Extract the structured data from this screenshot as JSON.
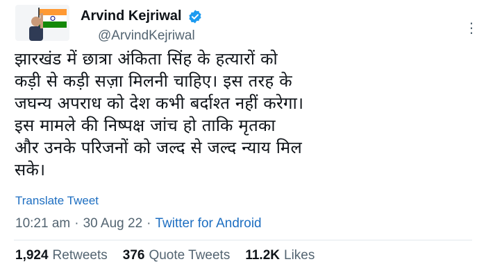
{
  "header": {
    "name": "Arvind Kejriwal",
    "handle": "@ArvindKejriwal",
    "verified_color": "#1d9bf0"
  },
  "tweet": {
    "text": "झारखंड में छात्रा अंकिता सिंह के हत्यारों को\nकड़ी से कड़ी सज़ा मिलनी चाहिए। इस तरह के\nजघन्य अपराध को देश कभी बर्दाश्त नहीं करेगा।\nइस मामले की निष्पक्ष जांच हो ताकि मृतका\nऔर उनके परिजनों को जल्द से जल्द न्याय मिल\nसके।",
    "translate_label": "Translate Tweet"
  },
  "meta": {
    "time": "10:21 am",
    "sep1": "·",
    "date": "30 Aug 22",
    "sep2": "·",
    "source": "Twitter for Android"
  },
  "stats": {
    "retweets_count": "1,924",
    "retweets_label": "Retweets",
    "quotes_count": "376",
    "quotes_label": "Quote Tweets",
    "likes_count": "11.2K",
    "likes_label": "Likes"
  },
  "icons": {
    "more": "more-options-icon",
    "verified": "verified-badge-icon"
  }
}
